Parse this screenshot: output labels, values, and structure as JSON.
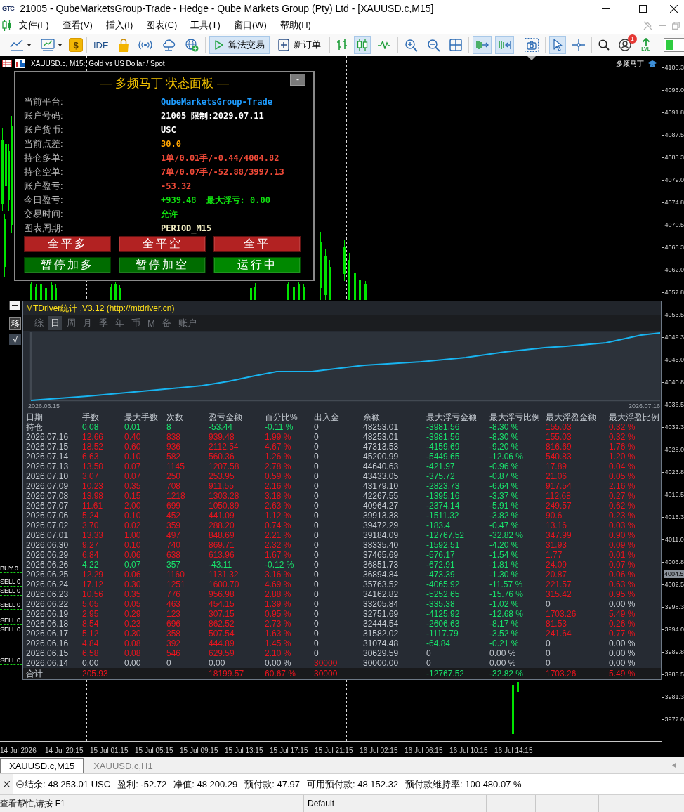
{
  "window": {
    "logo": "GTC",
    "title": "21005 - QubeMarketsGroup-Trade - Hedge - Qube Markets Group (Pty) Ltd - [XAUUSD.c,M15]"
  },
  "menu": [
    "文件(F)",
    "查看(V)",
    "插入(I)",
    "图表(C)",
    "工具(T)",
    "窗口(W)",
    "帮助(H)"
  ],
  "toolbar": {
    "groups": [
      [
        {
          "kind": "line-chart",
          "selected": false
        },
        {
          "kind": "template",
          "selected": false
        },
        {
          "kind": "coin",
          "label": "$",
          "selected": false
        }
      ],
      [
        {
          "kind": "ide",
          "label": "IDE",
          "selected": false
        },
        {
          "kind": "market",
          "selected": false
        },
        {
          "kind": "signals",
          "selected": false
        },
        {
          "kind": "cloud",
          "selected": false
        },
        {
          "kind": "globe",
          "selected": false
        }
      ],
      [
        {
          "kind": "algo",
          "label": "算法交易",
          "selected": true
        },
        {
          "kind": "order",
          "label": "新订单",
          "selected": false
        }
      ],
      [
        {
          "kind": "bars",
          "selected": false
        },
        {
          "kind": "candles",
          "selected": true
        },
        {
          "kind": "line",
          "selected": false
        }
      ],
      [
        {
          "kind": "zoom-in",
          "selected": false
        },
        {
          "kind": "zoom-out",
          "selected": false
        },
        {
          "kind": "tile",
          "selected": false
        }
      ],
      [
        {
          "kind": "autoscroll",
          "selected": true
        },
        {
          "kind": "shift",
          "selected": true
        }
      ],
      [
        {
          "kind": "screenshot",
          "selected": false
        }
      ],
      [
        {
          "kind": "cursor",
          "selected": true
        },
        {
          "kind": "crosshair",
          "selected": false
        }
      ],
      [
        {
          "kind": "search",
          "selected": false
        },
        {
          "kind": "profile",
          "badge": "1",
          "selected": false
        },
        {
          "kind": "level",
          "label": "LVL",
          "selected": false
        }
      ]
    ]
  },
  "chart": {
    "symbol": "XAUUSD.c, M15:",
    "description": "Gold vs US Dollar / Spot",
    "expert": "多频马丁",
    "price_ticks": [
      "4100.3",
      "4096.0",
      "4091.8",
      "4087.5",
      "4083.3",
      "4079.0",
      "4074.8",
      "4070.5",
      "4066.3",
      "4062.0",
      "4057.8",
      "4053.5",
      "4049.3",
      "4045.0",
      "4040.8",
      "4036.5",
      "4032.3",
      "4028.0",
      "4023.8",
      "4019.5",
      "4015.3",
      "4011.0",
      "4006.8",
      "4002.5",
      "3998.3",
      "3994.0",
      "3989.8",
      "3985.5",
      "3981.3",
      "3977.0"
    ],
    "current_price": "4004.5",
    "time_ticks": [
      "14 Jul 2026",
      "14 Jul 20:15",
      "15 Jul 01:15",
      "15 Jul 05:15",
      "15 Jul 09:15",
      "15 Jul 13:15",
      "15 Jul 17:15",
      "15 Jul 21:15",
      "16 Jul 02:15",
      "16 Jul 06:15",
      "16 Jul 10:15",
      "16 Jul 14:15"
    ],
    "order_labels": [
      "BUY 0",
      "SELL 0",
      "SELL 0",
      "SELL 0",
      "SELL 0",
      "SELL 0",
      "SELL 0"
    ]
  },
  "status_panel": {
    "title": "— 多频马丁 状态面板 —",
    "collapse_label": "-",
    "rows": [
      {
        "label": "当前平台:",
        "values": [
          {
            "text": "QubeMarketsGroup-Trade",
            "color": "#1e9cff"
          }
        ]
      },
      {
        "label": "账户号码:",
        "values": [
          {
            "text": "21005 限制:2029.07.11",
            "color": "#ffffff"
          }
        ]
      },
      {
        "label": "账户货币:",
        "values": [
          {
            "text": "USC",
            "color": "#ffffff"
          }
        ]
      },
      {
        "label": "当前点差:",
        "values": [
          {
            "text": "30.0",
            "color": "#ffa500"
          }
        ]
      },
      {
        "label": "持仓多单:",
        "values": [
          {
            "text": "1单/0.01手/-0.44/4004.82",
            "color": "#f04a38"
          }
        ]
      },
      {
        "label": "持仓空单:",
        "values": [
          {
            "text": "7单/0.07手/-52.88/3997.13",
            "color": "#f04a38"
          }
        ]
      },
      {
        "label": "账户盈亏:",
        "values": [
          {
            "text": "-53.32",
            "color": "#f04a38"
          }
        ]
      },
      {
        "label": "今日盈亏:",
        "values": [
          {
            "text": "+939.48",
            "color": "#10e010"
          },
          {
            "text": "最大浮亏: 0.00",
            "color": "#10e010"
          }
        ]
      },
      {
        "label": "交易时间:",
        "values": [
          {
            "text": "允许",
            "color": "#10e010"
          }
        ]
      },
      {
        "label": "图表周期:",
        "values": [
          {
            "text": "PERIOD_M15",
            "color": "#f3efc4"
          }
        ]
      }
    ],
    "buttons": [
      {
        "label": "全平多",
        "color": "#b22222"
      },
      {
        "label": "全平空",
        "color": "#b22222"
      },
      {
        "label": "全平",
        "color": "#b22222"
      },
      {
        "label": "暂停加多",
        "color": "#006c00"
      },
      {
        "label": "暂停加空",
        "color": "#006c00"
      },
      {
        "label": "运行中",
        "color": "#008800"
      }
    ]
  },
  "stats": {
    "title": "MTDriver统计 ,V3.12 (http://mtdriver.cn)",
    "side_buttons": [
      "移",
      "√"
    ],
    "tabs": [
      {
        "label": "综",
        "selected": false
      },
      {
        "label": "日",
        "selected": true
      },
      {
        "label": "周",
        "selected": false
      },
      {
        "label": "月",
        "selected": false
      },
      {
        "label": "季",
        "selected": false
      },
      {
        "label": "年",
        "selected": false
      },
      {
        "label": "币",
        "selected": false
      },
      {
        "label": "M",
        "selected": false
      },
      {
        "label": "备",
        "selected": false
      },
      {
        "label": "账户",
        "selected": false
      }
    ],
    "curve_dates": [
      "2026.06.15",
      "2026.07.16"
    ],
    "columns": [
      "日期",
      "手数",
      "最大手数",
      "次数",
      "盈亏金额",
      "百分比%",
      "出入金",
      "余额",
      "最大浮亏金额",
      "最大浮亏比例",
      "最大浮盈金额",
      "最大浮盈比例"
    ],
    "rows": [
      {
        "cells": [
          {
            "text": "持仓"
          },
          {
            "text": "0.08",
            "color": "#19e26c"
          },
          {
            "text": "0.01",
            "color": "#19e26c"
          },
          {
            "text": "8",
            "color": "#19e26c"
          },
          {
            "text": "-53.44",
            "color": "#19e26c"
          },
          {
            "text": "-0.11 %",
            "color": "#19e26c"
          },
          {
            "text": "0",
            "color": "#c5cbd2"
          },
          {
            "text": "48253.01",
            "color": "#c5cbd2"
          },
          {
            "text": "-3981.56",
            "color": "#19e26c"
          },
          {
            "text": "-8.30 %",
            "color": "#19e26c"
          },
          {
            "text": "155.03",
            "color": "#e8141e"
          },
          {
            "text": "0.32 %",
            "color": "#e8141e"
          }
        ]
      },
      {
        "cells": [
          {
            "text": "2026.07.16"
          },
          {
            "text": "12.66",
            "color": "#e8141e"
          },
          {
            "text": "0.40",
            "color": "#e8141e"
          },
          {
            "text": "838",
            "color": "#e8141e"
          },
          {
            "text": "939.48",
            "color": "#e8141e"
          },
          {
            "text": "1.99 %",
            "color": "#e8141e"
          },
          {
            "text": "0",
            "color": "#c5cbd2"
          },
          {
            "text": "48253.01",
            "color": "#c5cbd2"
          },
          {
            "text": "-3981.56",
            "color": "#19e26c"
          },
          {
            "text": "-8.30 %",
            "color": "#19e26c"
          },
          {
            "text": "155.03",
            "color": "#e8141e"
          },
          {
            "text": "0.32 %",
            "color": "#e8141e"
          }
        ]
      },
      {
        "cells": [
          {
            "text": "2026.07.15"
          },
          {
            "text": "18.52",
            "color": "#e8141e"
          },
          {
            "text": "0.60",
            "color": "#e8141e"
          },
          {
            "text": "936",
            "color": "#e8141e"
          },
          {
            "text": "2112.54",
            "color": "#e8141e"
          },
          {
            "text": "4.67 %",
            "color": "#e8141e"
          },
          {
            "text": "0",
            "color": "#c5cbd2"
          },
          {
            "text": "47313.53",
            "color": "#c5cbd2"
          },
          {
            "text": "-4159.69",
            "color": "#19e26c"
          },
          {
            "text": "-9.20 %",
            "color": "#19e26c"
          },
          {
            "text": "816.69",
            "color": "#e8141e"
          },
          {
            "text": "1.76 %",
            "color": "#e8141e"
          }
        ]
      },
      {
        "cells": [
          {
            "text": "2026.07.14"
          },
          {
            "text": "6.63",
            "color": "#e8141e"
          },
          {
            "text": "0.10",
            "color": "#e8141e"
          },
          {
            "text": "582",
            "color": "#e8141e"
          },
          {
            "text": "560.36",
            "color": "#e8141e"
          },
          {
            "text": "1.26 %",
            "color": "#e8141e"
          },
          {
            "text": "0",
            "color": "#c5cbd2"
          },
          {
            "text": "45200.99",
            "color": "#c5cbd2"
          },
          {
            "text": "-5449.65",
            "color": "#19e26c"
          },
          {
            "text": "-12.06 %",
            "color": "#19e26c"
          },
          {
            "text": "540.83",
            "color": "#e8141e"
          },
          {
            "text": "1.20 %",
            "color": "#e8141e"
          }
        ]
      },
      {
        "cells": [
          {
            "text": "2026.07.13"
          },
          {
            "text": "13.50",
            "color": "#e8141e"
          },
          {
            "text": "0.07",
            "color": "#e8141e"
          },
          {
            "text": "1145",
            "color": "#e8141e"
          },
          {
            "text": "1207.58",
            "color": "#e8141e"
          },
          {
            "text": "2.78 %",
            "color": "#e8141e"
          },
          {
            "text": "0",
            "color": "#c5cbd2"
          },
          {
            "text": "44640.63",
            "color": "#c5cbd2"
          },
          {
            "text": "-421.97",
            "color": "#19e26c"
          },
          {
            "text": "-0.96 %",
            "color": "#19e26c"
          },
          {
            "text": "17.89",
            "color": "#e8141e"
          },
          {
            "text": "0.04 %",
            "color": "#e8141e"
          }
        ]
      },
      {
        "cells": [
          {
            "text": "2026.07.10"
          },
          {
            "text": "3.07",
            "color": "#e8141e"
          },
          {
            "text": "0.07",
            "color": "#e8141e"
          },
          {
            "text": "250",
            "color": "#e8141e"
          },
          {
            "text": "253.95",
            "color": "#e8141e"
          },
          {
            "text": "0.59 %",
            "color": "#e8141e"
          },
          {
            "text": "0",
            "color": "#c5cbd2"
          },
          {
            "text": "43433.05",
            "color": "#c5cbd2"
          },
          {
            "text": "-375.72",
            "color": "#19e26c"
          },
          {
            "text": "-0.87 %",
            "color": "#19e26c"
          },
          {
            "text": "21.06",
            "color": "#e8141e"
          },
          {
            "text": "0.05 %",
            "color": "#e8141e"
          }
        ]
      },
      {
        "cells": [
          {
            "text": "2026.07.09"
          },
          {
            "text": "10.23",
            "color": "#e8141e"
          },
          {
            "text": "0.35",
            "color": "#e8141e"
          },
          {
            "text": "708",
            "color": "#e8141e"
          },
          {
            "text": "911.55",
            "color": "#e8141e"
          },
          {
            "text": "2.16 %",
            "color": "#e8141e"
          },
          {
            "text": "0",
            "color": "#c5cbd2"
          },
          {
            "text": "43179.10",
            "color": "#c5cbd2"
          },
          {
            "text": "-2823.73",
            "color": "#19e26c"
          },
          {
            "text": "-6.64 %",
            "color": "#19e26c"
          },
          {
            "text": "917.54",
            "color": "#e8141e"
          },
          {
            "text": "2.16 %",
            "color": "#e8141e"
          }
        ]
      },
      {
        "cells": [
          {
            "text": "2026.07.08"
          },
          {
            "text": "13.98",
            "color": "#e8141e"
          },
          {
            "text": "0.15",
            "color": "#e8141e"
          },
          {
            "text": "1218",
            "color": "#e8141e"
          },
          {
            "text": "1303.28",
            "color": "#e8141e"
          },
          {
            "text": "3.18 %",
            "color": "#e8141e"
          },
          {
            "text": "0",
            "color": "#c5cbd2"
          },
          {
            "text": "42267.55",
            "color": "#c5cbd2"
          },
          {
            "text": "-1395.16",
            "color": "#19e26c"
          },
          {
            "text": "-3.37 %",
            "color": "#19e26c"
          },
          {
            "text": "112.68",
            "color": "#e8141e"
          },
          {
            "text": "0.27 %",
            "color": "#e8141e"
          }
        ]
      },
      {
        "cells": [
          {
            "text": "2026.07.07"
          },
          {
            "text": "11.61",
            "color": "#e8141e"
          },
          {
            "text": "2.00",
            "color": "#e8141e"
          },
          {
            "text": "699",
            "color": "#e8141e"
          },
          {
            "text": "1050.89",
            "color": "#e8141e"
          },
          {
            "text": "2.63 %",
            "color": "#e8141e"
          },
          {
            "text": "0",
            "color": "#c5cbd2"
          },
          {
            "text": "40964.27",
            "color": "#c5cbd2"
          },
          {
            "text": "-2374.14",
            "color": "#19e26c"
          },
          {
            "text": "-5.91 %",
            "color": "#19e26c"
          },
          {
            "text": "249.57",
            "color": "#e8141e"
          },
          {
            "text": "0.62 %",
            "color": "#e8141e"
          }
        ]
      },
      {
        "cells": [
          {
            "text": "2026.07.06"
          },
          {
            "text": "5.24",
            "color": "#e8141e"
          },
          {
            "text": "0.10",
            "color": "#e8141e"
          },
          {
            "text": "452",
            "color": "#e8141e"
          },
          {
            "text": "441.09",
            "color": "#e8141e"
          },
          {
            "text": "1.12 %",
            "color": "#e8141e"
          },
          {
            "text": "0",
            "color": "#c5cbd2"
          },
          {
            "text": "39913.38",
            "color": "#c5cbd2"
          },
          {
            "text": "-1511.32",
            "color": "#19e26c"
          },
          {
            "text": "-3.82 %",
            "color": "#19e26c"
          },
          {
            "text": "90.6",
            "color": "#e8141e"
          },
          {
            "text": "0.23 %",
            "color": "#e8141e"
          }
        ]
      },
      {
        "cells": [
          {
            "text": "2026.07.02"
          },
          {
            "text": "3.70",
            "color": "#e8141e"
          },
          {
            "text": "0.02",
            "color": "#e8141e"
          },
          {
            "text": "359",
            "color": "#e8141e"
          },
          {
            "text": "288.20",
            "color": "#e8141e"
          },
          {
            "text": "0.74 %",
            "color": "#e8141e"
          },
          {
            "text": "0",
            "color": "#c5cbd2"
          },
          {
            "text": "39472.29",
            "color": "#c5cbd2"
          },
          {
            "text": "-183.4",
            "color": "#19e26c"
          },
          {
            "text": "-0.47 %",
            "color": "#19e26c"
          },
          {
            "text": "13.16",
            "color": "#e8141e"
          },
          {
            "text": "0.03 %",
            "color": "#e8141e"
          }
        ]
      },
      {
        "cells": [
          {
            "text": "2026.07.01"
          },
          {
            "text": "13.33",
            "color": "#e8141e"
          },
          {
            "text": "1.00",
            "color": "#e8141e"
          },
          {
            "text": "497",
            "color": "#e8141e"
          },
          {
            "text": "848.69",
            "color": "#e8141e"
          },
          {
            "text": "2.21 %",
            "color": "#e8141e"
          },
          {
            "text": "0",
            "color": "#c5cbd2"
          },
          {
            "text": "39184.09",
            "color": "#c5cbd2"
          },
          {
            "text": "-12767.52",
            "color": "#19e26c"
          },
          {
            "text": "-32.82 %",
            "color": "#19e26c"
          },
          {
            "text": "347.99",
            "color": "#e8141e"
          },
          {
            "text": "0.90 %",
            "color": "#e8141e"
          }
        ]
      },
      {
        "cells": [
          {
            "text": "2026.06.30"
          },
          {
            "text": "9.27",
            "color": "#e8141e"
          },
          {
            "text": "0.10",
            "color": "#e8141e"
          },
          {
            "text": "740",
            "color": "#e8141e"
          },
          {
            "text": "869.71",
            "color": "#e8141e"
          },
          {
            "text": "2.32 %",
            "color": "#e8141e"
          },
          {
            "text": "0",
            "color": "#c5cbd2"
          },
          {
            "text": "38335.40",
            "color": "#c5cbd2"
          },
          {
            "text": "-1592.51",
            "color": "#19e26c"
          },
          {
            "text": "-4.20 %",
            "color": "#19e26c"
          },
          {
            "text": "31.93",
            "color": "#e8141e"
          },
          {
            "text": "0.09 %",
            "color": "#e8141e"
          }
        ]
      },
      {
        "cells": [
          {
            "text": "2026.06.29"
          },
          {
            "text": "6.84",
            "color": "#e8141e"
          },
          {
            "text": "0.06",
            "color": "#e8141e"
          },
          {
            "text": "638",
            "color": "#e8141e"
          },
          {
            "text": "613.96",
            "color": "#e8141e"
          },
          {
            "text": "1.67 %",
            "color": "#e8141e"
          },
          {
            "text": "0",
            "color": "#c5cbd2"
          },
          {
            "text": "37465.69",
            "color": "#c5cbd2"
          },
          {
            "text": "-576.17",
            "color": "#19e26c"
          },
          {
            "text": "-1.54 %",
            "color": "#19e26c"
          },
          {
            "text": "1.77",
            "color": "#e8141e"
          },
          {
            "text": "0.01 %",
            "color": "#e8141e"
          }
        ]
      },
      {
        "cells": [
          {
            "text": "2026.06.26"
          },
          {
            "text": "4.22",
            "color": "#19e26c"
          },
          {
            "text": "0.07",
            "color": "#19e26c"
          },
          {
            "text": "357",
            "color": "#19e26c"
          },
          {
            "text": "-43.11",
            "color": "#19e26c"
          },
          {
            "text": "-0.12 %",
            "color": "#19e26c"
          },
          {
            "text": "0",
            "color": "#c5cbd2"
          },
          {
            "text": "36851.73",
            "color": "#c5cbd2"
          },
          {
            "text": "-672.91",
            "color": "#19e26c"
          },
          {
            "text": "-1.81 %",
            "color": "#19e26c"
          },
          {
            "text": "24.09",
            "color": "#e8141e"
          },
          {
            "text": "0.07 %",
            "color": "#e8141e"
          }
        ]
      },
      {
        "cells": [
          {
            "text": "2026.06.25"
          },
          {
            "text": "12.29",
            "color": "#e8141e"
          },
          {
            "text": "0.06",
            "color": "#e8141e"
          },
          {
            "text": "1160",
            "color": "#e8141e"
          },
          {
            "text": "1131.32",
            "color": "#e8141e"
          },
          {
            "text": "3.16 %",
            "color": "#e8141e"
          },
          {
            "text": "0",
            "color": "#c5cbd2"
          },
          {
            "text": "36894.84",
            "color": "#c5cbd2"
          },
          {
            "text": "-473.39",
            "color": "#19e26c"
          },
          {
            "text": "-1.30 %",
            "color": "#19e26c"
          },
          {
            "text": "20.87",
            "color": "#e8141e"
          },
          {
            "text": "0.06 %",
            "color": "#e8141e"
          }
        ]
      },
      {
        "cells": [
          {
            "text": "2026.06.24"
          },
          {
            "text": "17.12",
            "color": "#e8141e"
          },
          {
            "text": "0.30",
            "color": "#e8141e"
          },
          {
            "text": "1251",
            "color": "#e8141e"
          },
          {
            "text": "1600.70",
            "color": "#e8141e"
          },
          {
            "text": "4.69 %",
            "color": "#e8141e"
          },
          {
            "text": "0",
            "color": "#c5cbd2"
          },
          {
            "text": "35763.52",
            "color": "#c5cbd2"
          },
          {
            "text": "-4065.92",
            "color": "#19e26c"
          },
          {
            "text": "-11.57 %",
            "color": "#19e26c"
          },
          {
            "text": "221.57",
            "color": "#e8141e"
          },
          {
            "text": "0.63 %",
            "color": "#e8141e"
          }
        ]
      },
      {
        "cells": [
          {
            "text": "2026.06.23"
          },
          {
            "text": "10.56",
            "color": "#e8141e"
          },
          {
            "text": "0.35",
            "color": "#e8141e"
          },
          {
            "text": "776",
            "color": "#e8141e"
          },
          {
            "text": "956.98",
            "color": "#e8141e"
          },
          {
            "text": "2.88 %",
            "color": "#e8141e"
          },
          {
            "text": "0",
            "color": "#c5cbd2"
          },
          {
            "text": "34162.82",
            "color": "#c5cbd2"
          },
          {
            "text": "-5252.65",
            "color": "#19e26c"
          },
          {
            "text": "-15.76 %",
            "color": "#19e26c"
          },
          {
            "text": "315.42",
            "color": "#e8141e"
          },
          {
            "text": "0.95 %",
            "color": "#e8141e"
          }
        ]
      },
      {
        "cells": [
          {
            "text": "2026.06.22"
          },
          {
            "text": "5.05",
            "color": "#e8141e"
          },
          {
            "text": "0.05",
            "color": "#e8141e"
          },
          {
            "text": "463",
            "color": "#e8141e"
          },
          {
            "text": "454.15",
            "color": "#e8141e"
          },
          {
            "text": "1.39 %",
            "color": "#e8141e"
          },
          {
            "text": "0",
            "color": "#c5cbd2"
          },
          {
            "text": "33205.84",
            "color": "#c5cbd2"
          },
          {
            "text": "-335.38",
            "color": "#19e26c"
          },
          {
            "text": "-1.02 %",
            "color": "#19e26c"
          },
          {
            "text": "0",
            "color": "#c5cbd2"
          },
          {
            "text": "0.00 %",
            "color": "#c5cbd2"
          }
        ]
      },
      {
        "cells": [
          {
            "text": "2026.06.19"
          },
          {
            "text": "2.95",
            "color": "#e8141e"
          },
          {
            "text": "0.29",
            "color": "#e8141e"
          },
          {
            "text": "123",
            "color": "#e8141e"
          },
          {
            "text": "307.15",
            "color": "#e8141e"
          },
          {
            "text": "0.95 %",
            "color": "#e8141e"
          },
          {
            "text": "0",
            "color": "#c5cbd2"
          },
          {
            "text": "32751.69",
            "color": "#c5cbd2"
          },
          {
            "text": "-4125.92",
            "color": "#19e26c"
          },
          {
            "text": "-12.68 %",
            "color": "#19e26c"
          },
          {
            "text": "1703.26",
            "color": "#e8141e"
          },
          {
            "text": "5.49 %",
            "color": "#e8141e"
          }
        ]
      },
      {
        "cells": [
          {
            "text": "2026.06.18"
          },
          {
            "text": "8.54",
            "color": "#e8141e"
          },
          {
            "text": "0.23",
            "color": "#e8141e"
          },
          {
            "text": "696",
            "color": "#e8141e"
          },
          {
            "text": "862.52",
            "color": "#e8141e"
          },
          {
            "text": "2.73 %",
            "color": "#e8141e"
          },
          {
            "text": "0",
            "color": "#c5cbd2"
          },
          {
            "text": "32444.54",
            "color": "#c5cbd2"
          },
          {
            "text": "-2606.63",
            "color": "#19e26c"
          },
          {
            "text": "-8.17 %",
            "color": "#19e26c"
          },
          {
            "text": "81.53",
            "color": "#e8141e"
          },
          {
            "text": "0.26 %",
            "color": "#e8141e"
          }
        ]
      },
      {
        "cells": [
          {
            "text": "2026.06.17"
          },
          {
            "text": "5.12",
            "color": "#e8141e"
          },
          {
            "text": "0.30",
            "color": "#e8141e"
          },
          {
            "text": "358",
            "color": "#e8141e"
          },
          {
            "text": "507.54",
            "color": "#e8141e"
          },
          {
            "text": "1.63 %",
            "color": "#e8141e"
          },
          {
            "text": "0",
            "color": "#c5cbd2"
          },
          {
            "text": "31582.02",
            "color": "#c5cbd2"
          },
          {
            "text": "-1117.79",
            "color": "#19e26c"
          },
          {
            "text": "-3.52 %",
            "color": "#19e26c"
          },
          {
            "text": "241.64",
            "color": "#e8141e"
          },
          {
            "text": "0.77 %",
            "color": "#e8141e"
          }
        ]
      },
      {
        "cells": [
          {
            "text": "2026.06.16"
          },
          {
            "text": "4.84",
            "color": "#e8141e"
          },
          {
            "text": "0.08",
            "color": "#e8141e"
          },
          {
            "text": "392",
            "color": "#e8141e"
          },
          {
            "text": "444.89",
            "color": "#e8141e"
          },
          {
            "text": "1.45 %",
            "color": "#e8141e"
          },
          {
            "text": "0",
            "color": "#c5cbd2"
          },
          {
            "text": "31074.48",
            "color": "#c5cbd2"
          },
          {
            "text": "-64.84",
            "color": "#19e26c"
          },
          {
            "text": "-0.21 %",
            "color": "#19e26c"
          },
          {
            "text": "0",
            "color": "#c5cbd2"
          },
          {
            "text": "0.00 %",
            "color": "#c5cbd2"
          }
        ]
      },
      {
        "cells": [
          {
            "text": "2026.06.15"
          },
          {
            "text": "6.58",
            "color": "#e8141e"
          },
          {
            "text": "0.08",
            "color": "#e8141e"
          },
          {
            "text": "546",
            "color": "#e8141e"
          },
          {
            "text": "629.59",
            "color": "#e8141e"
          },
          {
            "text": "2.10 %",
            "color": "#e8141e"
          },
          {
            "text": "0",
            "color": "#c5cbd2"
          },
          {
            "text": "30629.59",
            "color": "#c5cbd2"
          },
          {
            "text": "0",
            "color": "#c5cbd2"
          },
          {
            "text": "0.00 %",
            "color": "#c5cbd2"
          },
          {
            "text": "0",
            "color": "#c5cbd2"
          },
          {
            "text": "0.00 %",
            "color": "#c5cbd2"
          }
        ]
      },
      {
        "cells": [
          {
            "text": "2026.06.14"
          },
          {
            "text": "0.00",
            "color": "#c5cbd2"
          },
          {
            "text": "0.00",
            "color": "#c5cbd2"
          },
          {
            "text": "0",
            "color": "#c5cbd2"
          },
          {
            "text": "0.00",
            "color": "#c5cbd2"
          },
          {
            "text": "0.00 %",
            "color": "#c5cbd2"
          },
          {
            "text": "30000",
            "color": "#e8141e"
          },
          {
            "text": "30000.00",
            "color": "#c5cbd2"
          },
          {
            "text": "0",
            "color": "#c5cbd2"
          },
          {
            "text": "0.00 %",
            "color": "#c5cbd2"
          },
          {
            "text": "0",
            "color": "#c5cbd2"
          },
          {
            "text": "0.00 %",
            "color": "#c5cbd2"
          }
        ]
      }
    ],
    "total": {
      "cells": [
        {
          "text": "合计"
        },
        {
          "text": "205.93",
          "color": "#e8141e"
        },
        "",
        "",
        {
          "text": "18199.57",
          "color": "#e8141e"
        },
        {
          "text": "60.67 %",
          "color": "#e8141e"
        },
        {
          "text": "30000",
          "color": "#e8141e"
        },
        "",
        {
          "text": "-12767.52",
          "color": "#19e26c"
        },
        {
          "text": "-32.82 %",
          "color": "#19e26c"
        },
        {
          "text": "1703.26",
          "color": "#e8141e"
        },
        {
          "text": "5.49 %",
          "color": "#e8141e"
        }
      ]
    }
  },
  "chart_tabs": [
    {
      "label": "XAUUSD.c,M15",
      "selected": true
    },
    {
      "label": "XAUUSD.c,H1",
      "selected": false
    }
  ],
  "account": [
    "结余: 48 253.01 USC",
    "盈利: -52.72",
    "净值: 48 200.29",
    "预付款: 47.97",
    "可用预付款: 48 152.32",
    "预付款维持率: 100 480.07 %"
  ],
  "status_bar": {
    "hint": "查看帮忙,请按 F1",
    "profile": "Default"
  }
}
